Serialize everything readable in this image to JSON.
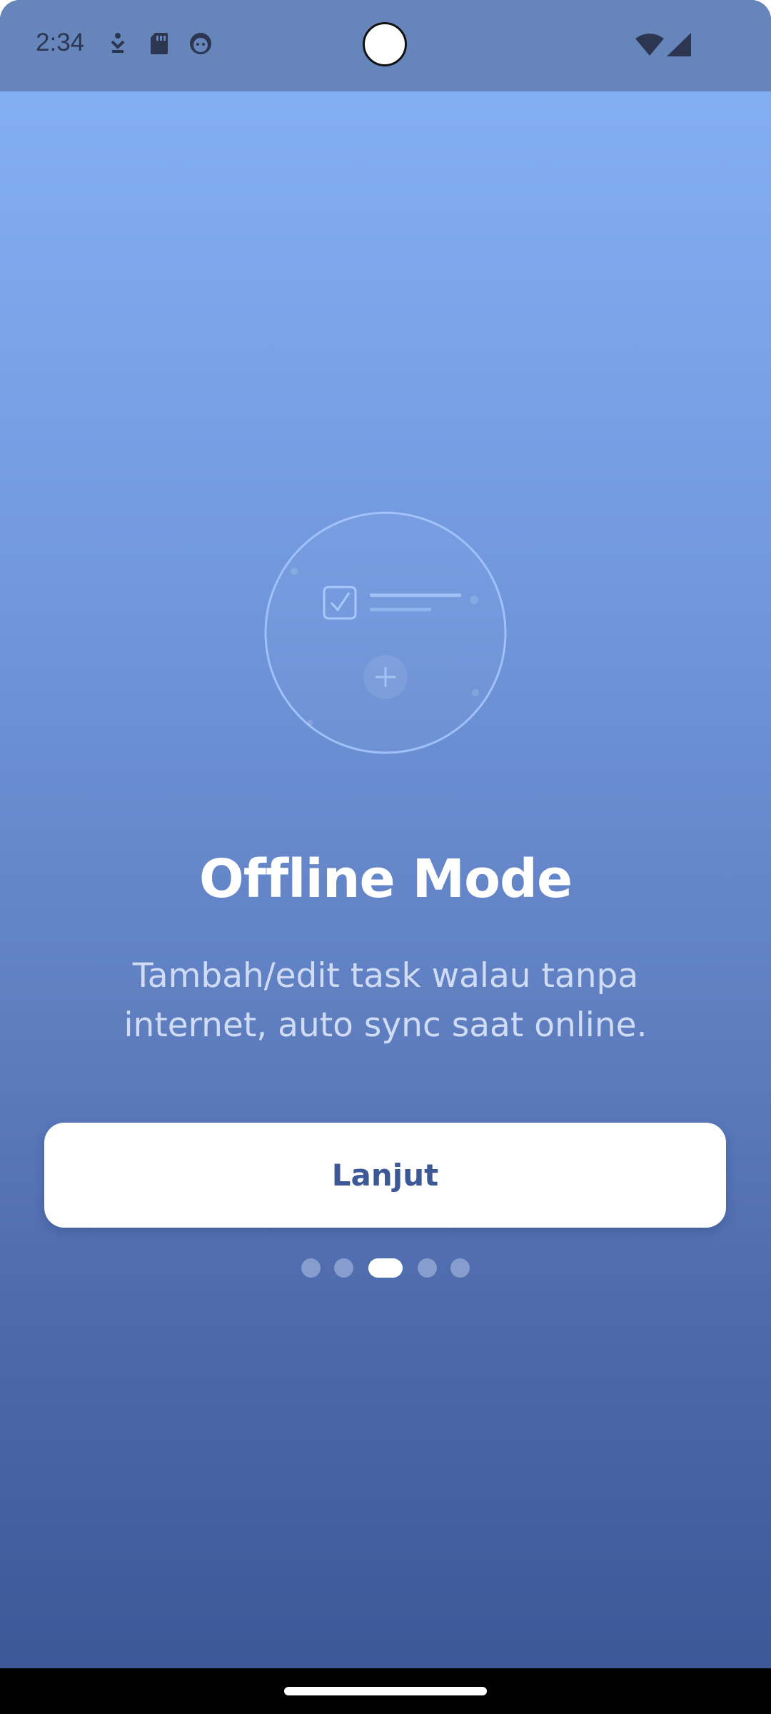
{
  "status_bar": {
    "time": "2:34",
    "left_icons": [
      "download-notification-icon",
      "sd-card-icon",
      "face-notification-icon"
    ],
    "right_icons": [
      "wifi-icon",
      "cellular-signal-icon"
    ]
  },
  "illustration": {
    "icons": [
      "checkbox-checked-icon",
      "plus-icon"
    ]
  },
  "onboarding": {
    "title": "Offline Mode",
    "description": "Tambah/edit task walau tanpa internet, auto sync saat online.",
    "next_label": "Lanjut",
    "page_total": 5,
    "current_page": 3
  },
  "colors": {
    "gradient_top": "#84aef3",
    "gradient_bottom": "#3c5897",
    "status_bar": "#6585bb",
    "button_text": "#3d5896"
  }
}
